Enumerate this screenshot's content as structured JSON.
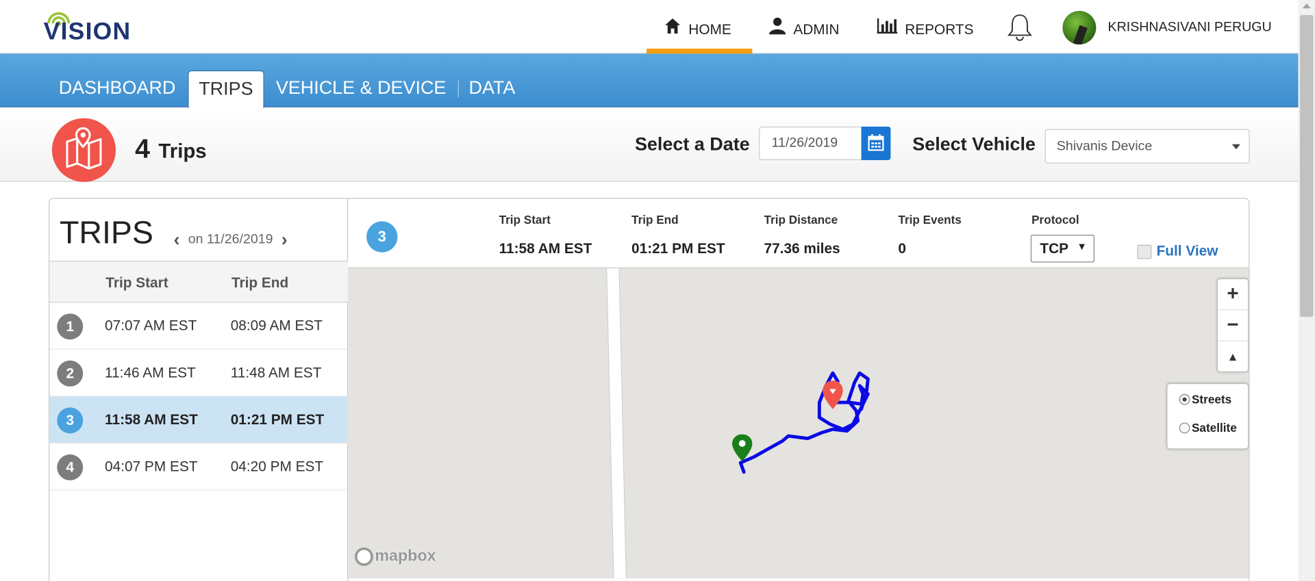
{
  "header": {
    "logo_text": "VISION",
    "nav": [
      {
        "label": "HOME",
        "icon": "home-icon",
        "active": true
      },
      {
        "label": "ADMIN",
        "icon": "user-icon",
        "active": false
      },
      {
        "label": "REPORTS",
        "icon": "bar-chart-icon",
        "active": false
      }
    ],
    "notifications_icon": "bell-icon",
    "user_name": "KRISHNASIVANI PERUGU",
    "accent_color": "#f39c12"
  },
  "tabs": [
    {
      "label": "DASHBOARD",
      "active": false
    },
    {
      "label": "TRIPS",
      "active": true
    },
    {
      "label": "VEHICLE & DEVICE",
      "active": false
    },
    {
      "label": "DATA",
      "active": false
    }
  ],
  "subheader": {
    "trip_count": "4",
    "trip_count_label": "Trips",
    "date_label": "Select a Date",
    "date_value": "11/26/2019",
    "vehicle_label": "Select Vehicle",
    "vehicle_value": "Shivanis Device"
  },
  "trips_panel": {
    "title": "TRIPS",
    "pager_text": "on 11/26/2019",
    "columns": [
      "Trip Start",
      "Trip End"
    ],
    "rows": [
      {
        "num": "1",
        "start": "07:07 AM EST",
        "end": "08:09 AM EST",
        "selected": false
      },
      {
        "num": "2",
        "start": "11:46 AM EST",
        "end": "11:48 AM EST",
        "selected": false
      },
      {
        "num": "3",
        "start": "11:58 AM EST",
        "end": "01:21 PM EST",
        "selected": true
      },
      {
        "num": "4",
        "start": "04:07 PM EST",
        "end": "04:20 PM EST",
        "selected": false
      }
    ]
  },
  "trip_detail": {
    "number": "3",
    "labels": {
      "start": "Trip Start",
      "end": "Trip End",
      "distance": "Trip Distance",
      "events": "Trip Events",
      "protocol": "Protocol"
    },
    "start": "11:58 AM EST",
    "end": "01:21 PM EST",
    "distance": "77.36 miles",
    "events": "0",
    "protocol": "TCP",
    "full_view": "Full View"
  },
  "map": {
    "zoom_in": "+",
    "zoom_out": "−",
    "compass": "▲",
    "layers": [
      {
        "label": "Streets",
        "selected": true
      },
      {
        "label": "Satellite",
        "selected": false
      }
    ],
    "attribution": "mapbox",
    "route_color": "#0a0ae6",
    "start_marker_color": "#1a7f1a",
    "end_marker_color": "#f0544a"
  }
}
